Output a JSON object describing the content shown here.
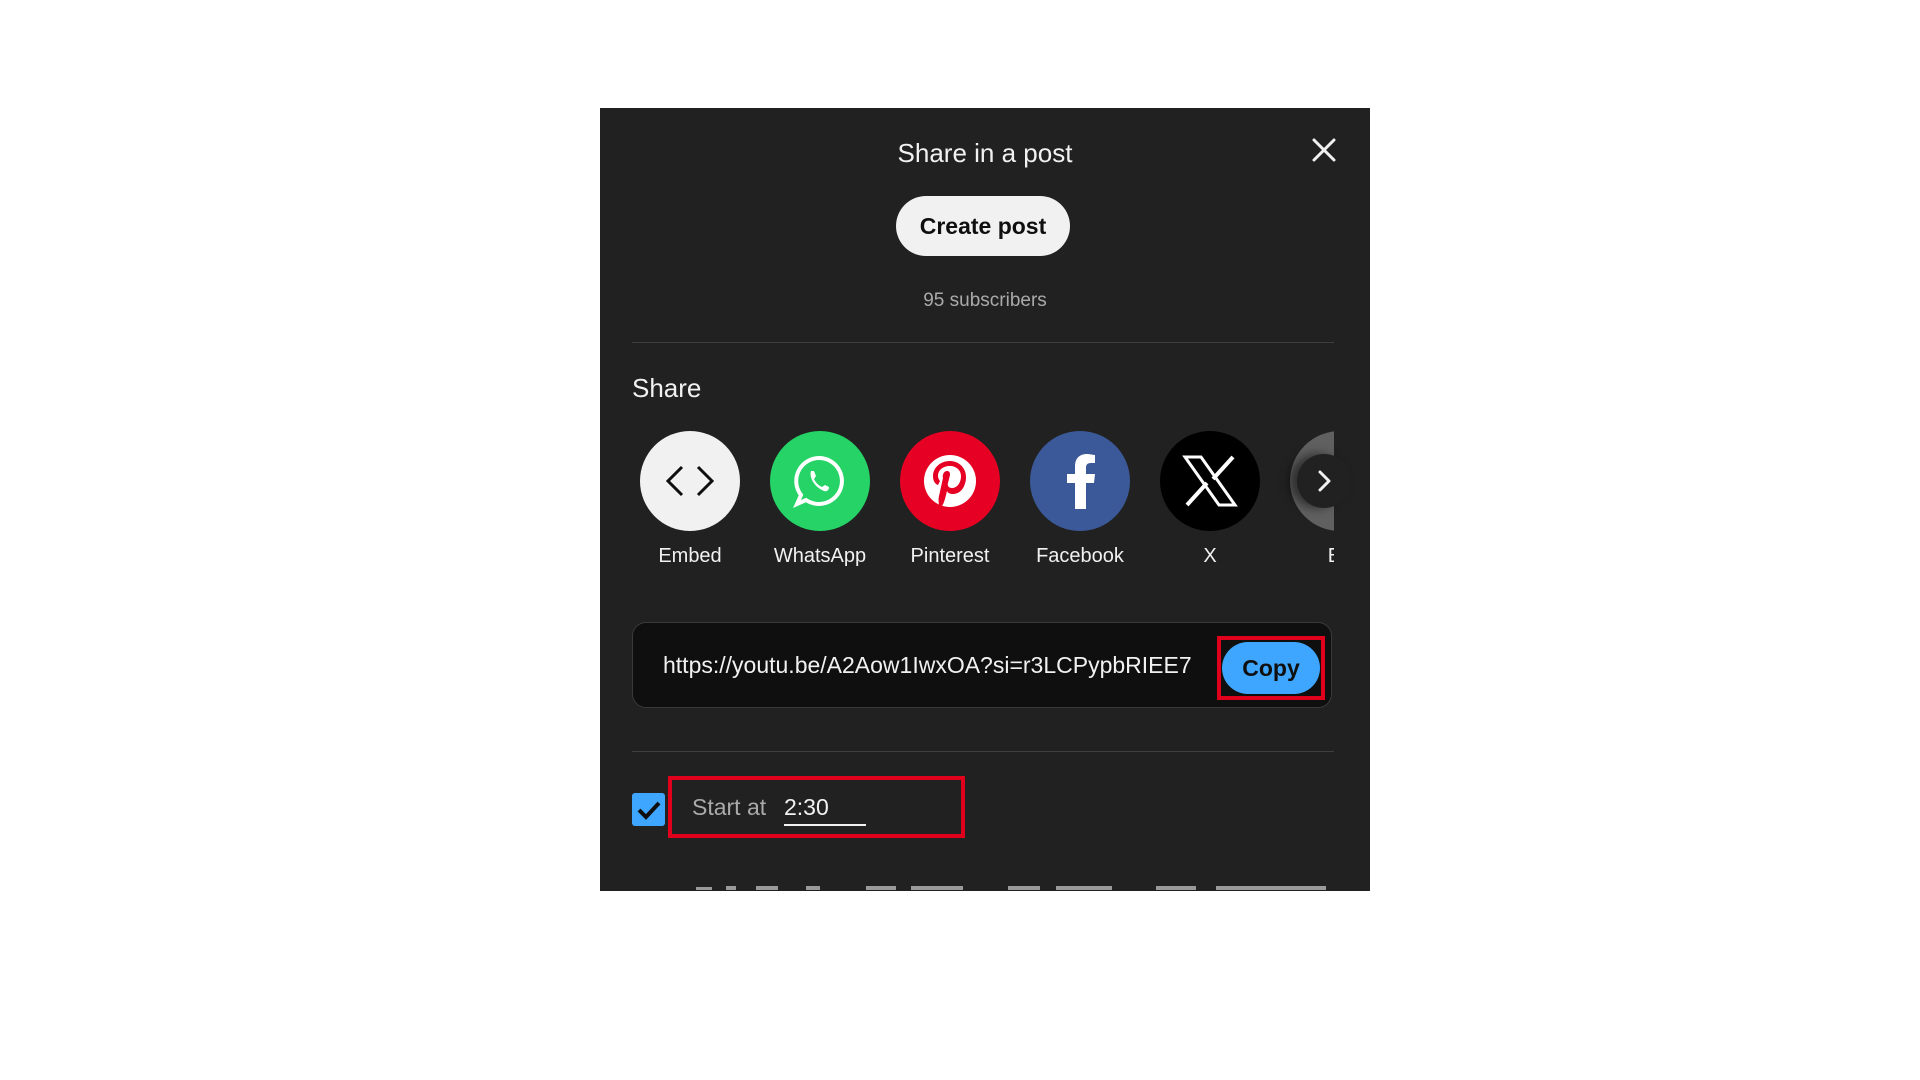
{
  "dialog": {
    "title": "Share in a post",
    "close_icon": "close-icon",
    "create_post_label": "Create post",
    "subscribers_text": "95 subscribers"
  },
  "share": {
    "heading": "Share",
    "items": [
      {
        "label": "Embed",
        "icon": "embed-icon",
        "color": "#f1f1f1"
      },
      {
        "label": "WhatsApp",
        "icon": "whatsapp-icon",
        "color": "#25d366"
      },
      {
        "label": "Pinterest",
        "icon": "pinterest-icon",
        "color": "#e60023"
      },
      {
        "label": "Facebook",
        "icon": "facebook-icon",
        "color": "#3b5998"
      },
      {
        "label": "X",
        "icon": "x-icon",
        "color": "#000000"
      },
      {
        "label": "En",
        "icon": "email-icon",
        "color": "#606060"
      }
    ],
    "next_icon": "chevron-right-icon"
  },
  "link": {
    "url": "https://youtu.be/A2Aow1IwxOA?si=r3LCPypbRIEE7",
    "copy_label": "Copy",
    "copy_color": "#3ea6ff"
  },
  "start": {
    "checked": true,
    "label": "Start at",
    "value": "2:30"
  },
  "colors": {
    "background": "#212121",
    "highlight": "#e0001b",
    "accent": "#3ea6ff"
  }
}
